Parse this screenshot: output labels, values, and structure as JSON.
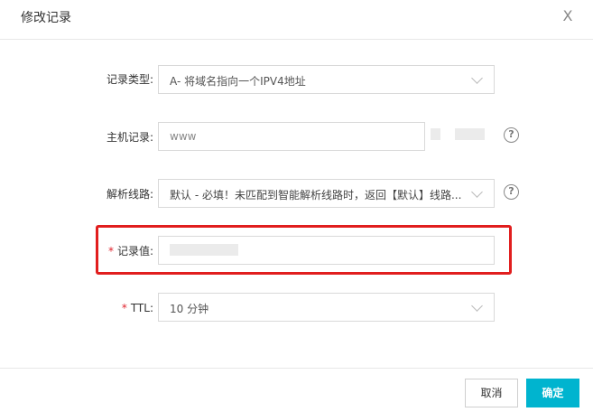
{
  "dialog": {
    "title": "修改记录",
    "close_glyph": "X"
  },
  "form": {
    "record_type": {
      "label": "记录类型:",
      "value": "A- 将域名指向一个IPV4地址",
      "icon": "chevron-down-icon"
    },
    "host_record": {
      "label": "主机记录:",
      "value": "www",
      "help": "?"
    },
    "resolve_line": {
      "label": "解析线路:",
      "value": "默认 - 必填！未匹配到智能解析线路时，返回【默认】线路...",
      "help": "?",
      "icon": "chevron-down-icon"
    },
    "record_value": {
      "required_mark": "*",
      "label": "记录值:",
      "value": ""
    },
    "ttl": {
      "required_mark": "*",
      "label": "TTL:",
      "value": "10 分钟",
      "icon": "chevron-down-icon"
    }
  },
  "footer": {
    "cancel_label": "取消",
    "confirm_label": "确定"
  },
  "colors": {
    "primary": "#00b4cf",
    "highlight": "#e11e1e",
    "required": "#e0242e"
  }
}
